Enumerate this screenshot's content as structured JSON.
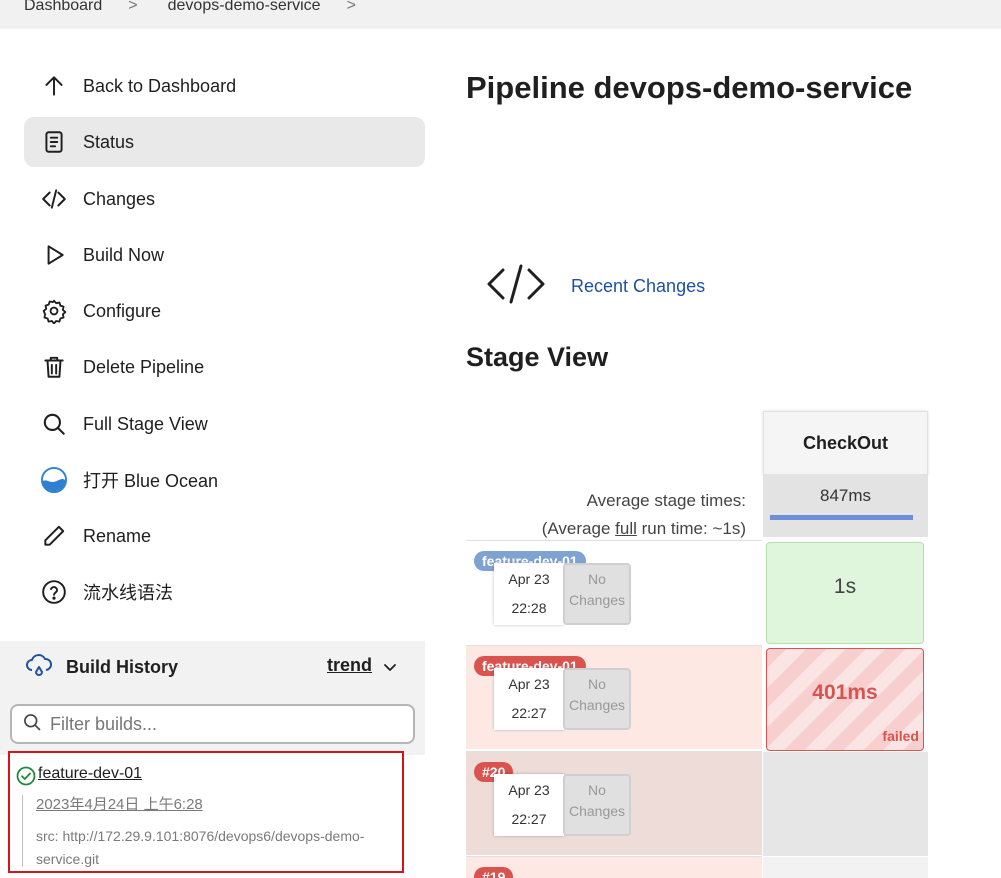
{
  "breadcrumb": {
    "items": [
      "Dashboard",
      "devops-demo-service"
    ],
    "separator": ">"
  },
  "sidebar": {
    "items": [
      {
        "label": "Back to Dashboard",
        "icon": "arrow-up-icon"
      },
      {
        "label": "Status",
        "icon": "document-icon",
        "active": true
      },
      {
        "label": "Changes",
        "icon": "code-icon"
      },
      {
        "label": "Build Now",
        "icon": "play-icon"
      },
      {
        "label": "Configure",
        "icon": "gear-icon"
      },
      {
        "label": "Delete Pipeline",
        "icon": "trash-icon"
      },
      {
        "label": "Full Stage View",
        "icon": "search-icon"
      },
      {
        "label": "打开 Blue Ocean",
        "icon": "blue-ocean-icon"
      },
      {
        "label": "Rename",
        "icon": "pencil-icon"
      },
      {
        "label": "流水线语法",
        "icon": "help-icon"
      }
    ]
  },
  "build_history": {
    "title": "Build History",
    "trend_label": "trend",
    "filter_placeholder": "Filter builds...",
    "entries": [
      {
        "name": "feature-dev-01",
        "date": "2023年4月24日 上午6:28",
        "src": "src: http://172.29.9.101:8076/devops6/devops-demo-service.git",
        "status": "success"
      }
    ]
  },
  "main": {
    "title": "Pipeline devops-demo-service",
    "recent_changes": "Recent Changes",
    "stage_view_title": "Stage View"
  },
  "stage_view": {
    "stages": [
      "CheckOut"
    ],
    "avg_label": "Average stage times:",
    "avg_full_prefix": "(Average ",
    "avg_full_link": "full",
    "avg_full_suffix": " run time: ~1s)",
    "avg_times": [
      "847ms"
    ],
    "runs": [
      {
        "badge": "feature-dev-01",
        "badge_color": "#7fa3d0",
        "date": "Apr 23",
        "time": "22:28",
        "changes": "No Changes",
        "row_bg": "#ffffff",
        "result": "1s",
        "status": "success"
      },
      {
        "badge": "feature-dev-01",
        "badge_color": "#d9534f",
        "date": "Apr 23",
        "time": "22:27",
        "changes": "No Changes",
        "row_bg": "#fde8e4",
        "result": "401ms",
        "status": "failed",
        "status_label": "failed"
      },
      {
        "badge": "#20",
        "badge_color": "#d9534f",
        "date": "Apr 23",
        "time": "22:27",
        "changes": "No Changes",
        "row_bg": "#eedcd8",
        "result": "",
        "status": "none"
      },
      {
        "badge": "#19",
        "badge_color": "#d9534f",
        "row_bg": "#fde8e4"
      }
    ]
  }
}
